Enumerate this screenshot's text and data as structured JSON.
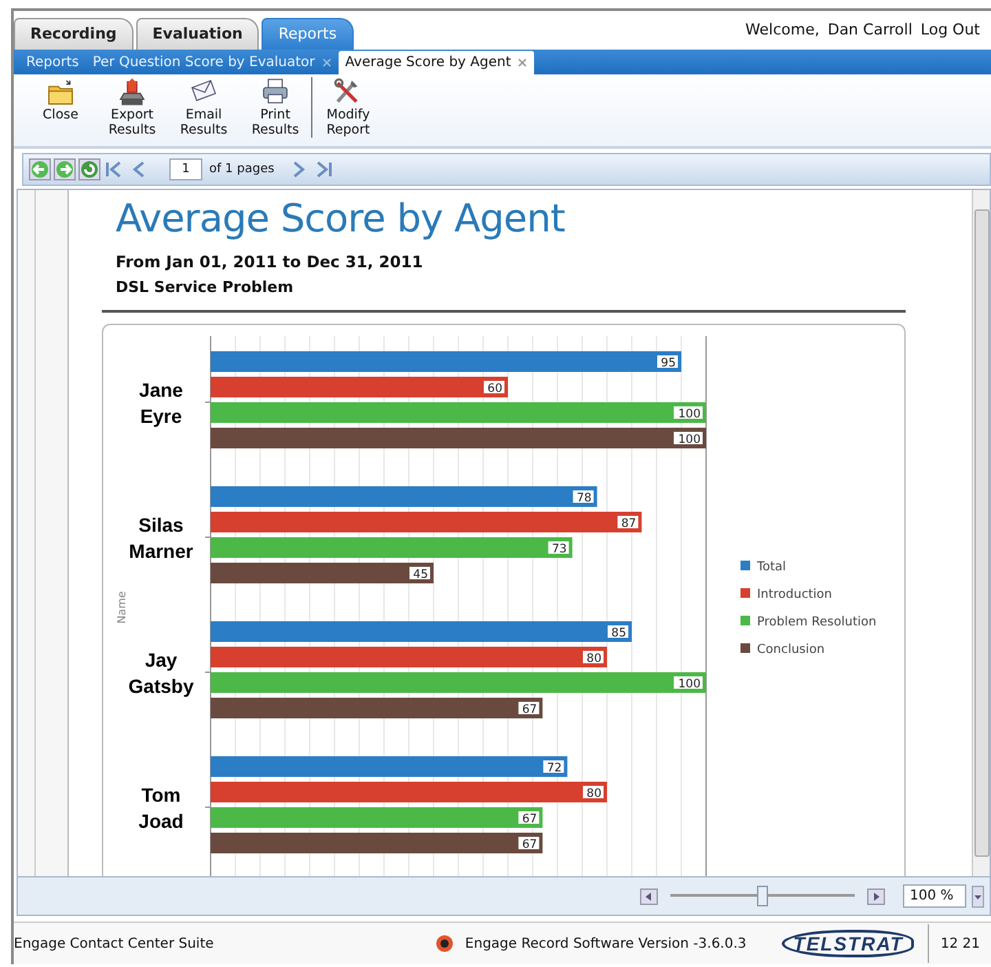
{
  "app_tabs": [
    {
      "label": "Recording",
      "selected": false
    },
    {
      "label": "Evaluation",
      "selected": false
    },
    {
      "label": "Reports",
      "selected": true
    }
  ],
  "user_bar": {
    "welcome": "Welcome,",
    "user": "Dan Carroll",
    "logout": "Log Out"
  },
  "doc_tabs": [
    {
      "label": "Reports",
      "selected": false,
      "closable": false
    },
    {
      "label": "Per Question Score by Evaluator",
      "selected": false,
      "closable": true
    },
    {
      "label": "Average Score by Agent",
      "selected": true,
      "closable": true
    }
  ],
  "toolbar": [
    {
      "label": "Close",
      "kind": "folder"
    },
    {
      "label": "Export Results",
      "kind": "export"
    },
    {
      "label": "Email Results",
      "kind": "email"
    },
    {
      "label": "Print Results",
      "kind": "print"
    },
    {
      "label": "Modify Report",
      "kind": "tools"
    }
  ],
  "pager": {
    "page": "1",
    "of": "of 1 pages"
  },
  "report": {
    "title": "Average Score by Agent",
    "date_range": "From Jan 01, 2011 to Dec 31, 2011",
    "subtitle": "DSL Service Problem",
    "chart_data": {
      "type": "bar",
      "orientation": "horizontal",
      "ylabel": "Name",
      "categories": [
        "Jane Eyre",
        "Silas Marner",
        "Jay Gatsby",
        "Tom Joad"
      ],
      "data_labels": true,
      "legend": "right",
      "series": [
        {
          "name": "Total",
          "color": "#2b7dc6",
          "values": [
            95,
            78,
            85,
            72
          ]
        },
        {
          "name": "Introduction",
          "color": "#d7402e",
          "values": [
            60,
            87,
            80,
            80
          ]
        },
        {
          "name": "Problem Resolution",
          "color": "#4cb848",
          "values": [
            100,
            73,
            100,
            67
          ]
        },
        {
          "name": "Conclusion",
          "color": "#6a4a3f",
          "values": [
            100,
            45,
            67,
            67
          ]
        }
      ]
    }
  },
  "zoom": {
    "level": 0.5,
    "value": "100 %"
  },
  "status_bar": {
    "suite": "Engage Contact Center Suite",
    "version": "Engage Record Software Version -3.6.0.3",
    "logo": "TELSTRAT",
    "time": "12 21"
  }
}
